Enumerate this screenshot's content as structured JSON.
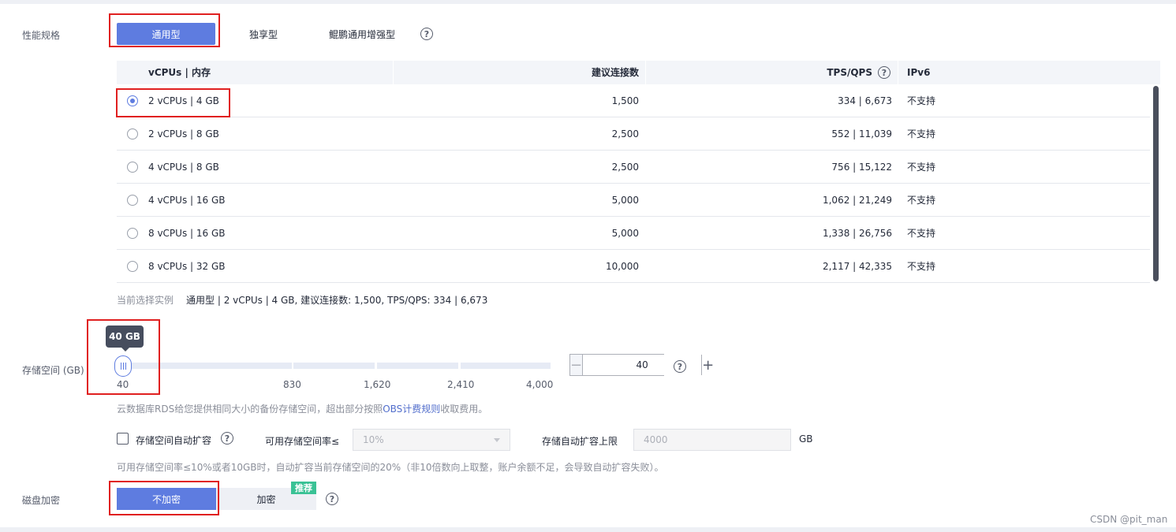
{
  "spec": {
    "label": "性能规格",
    "tabs": [
      "通用型",
      "独享型",
      "鲲鹏通用增强型"
    ],
    "active_tab": 0,
    "help_icon": "question-circle-icon"
  },
  "table": {
    "headers": [
      "vCPUs | 内存",
      "建议连接数",
      "TPS/QPS",
      "IPv6"
    ],
    "rows": [
      {
        "cpu_mem": "2 vCPUs | 4 GB",
        "connections": "1,500",
        "tps_qps": "334 | 6,673",
        "ipv6": "不支持",
        "selected": true
      },
      {
        "cpu_mem": "2 vCPUs | 8 GB",
        "connections": "2,500",
        "tps_qps": "552 | 11,039",
        "ipv6": "不支持",
        "selected": false
      },
      {
        "cpu_mem": "4 vCPUs | 8 GB",
        "connections": "2,500",
        "tps_qps": "756 | 15,122",
        "ipv6": "不支持",
        "selected": false
      },
      {
        "cpu_mem": "4 vCPUs | 16 GB",
        "connections": "5,000",
        "tps_qps": "1,062 | 21,249",
        "ipv6": "不支持",
        "selected": false
      },
      {
        "cpu_mem": "8 vCPUs | 16 GB",
        "connections": "5,000",
        "tps_qps": "1,338 | 26,756",
        "ipv6": "不支持",
        "selected": false
      },
      {
        "cpu_mem": "8 vCPUs | 32 GB",
        "connections": "10,000",
        "tps_qps": "2,117 | 42,335",
        "ipv6": "不支持",
        "selected": false
      }
    ]
  },
  "current_selection": {
    "label": "当前选择实例",
    "value": "通用型 | 2 vCPUs | 4 GB, 建议连接数: 1,500, TPS/QPS: 334 | 6,673"
  },
  "storage": {
    "label": "存储空间 (GB)",
    "tooltip": "40 GB",
    "value": 40,
    "min": 40,
    "max": 4000,
    "ticks": [
      "40",
      "830",
      "1,620",
      "2,410",
      "4,000"
    ],
    "input_value": "40",
    "minus": "−",
    "plus": "+",
    "note_prefix": "云数据库RDS给您提供相同大小的备份存储空间，超出部分按照",
    "note_link": "OBS计费规则",
    "note_suffix": "收取费用。"
  },
  "autoscale": {
    "checkbox_label": "存储空间自动扩容",
    "rate_label": "可用存储空间率≤",
    "rate_value": "10%",
    "limit_label": "存储自动扩容上限",
    "limit_placeholder": "4000",
    "unit": "GB",
    "note": "可用存储空间率≤10%或者10GB时，自动扩容当前存储空间的20%（非10倍数向上取整，账户余额不足，会导致自动扩容失败）。"
  },
  "encryption": {
    "label": "磁盘加密",
    "options": [
      "不加密",
      "加密"
    ],
    "badge": "推荐",
    "active": 0
  },
  "watermark": "CSDN @pit_man",
  "colors": {
    "primary": "#5e7ce0",
    "highlight_box": "#e02020",
    "badge": "#3ac295"
  }
}
